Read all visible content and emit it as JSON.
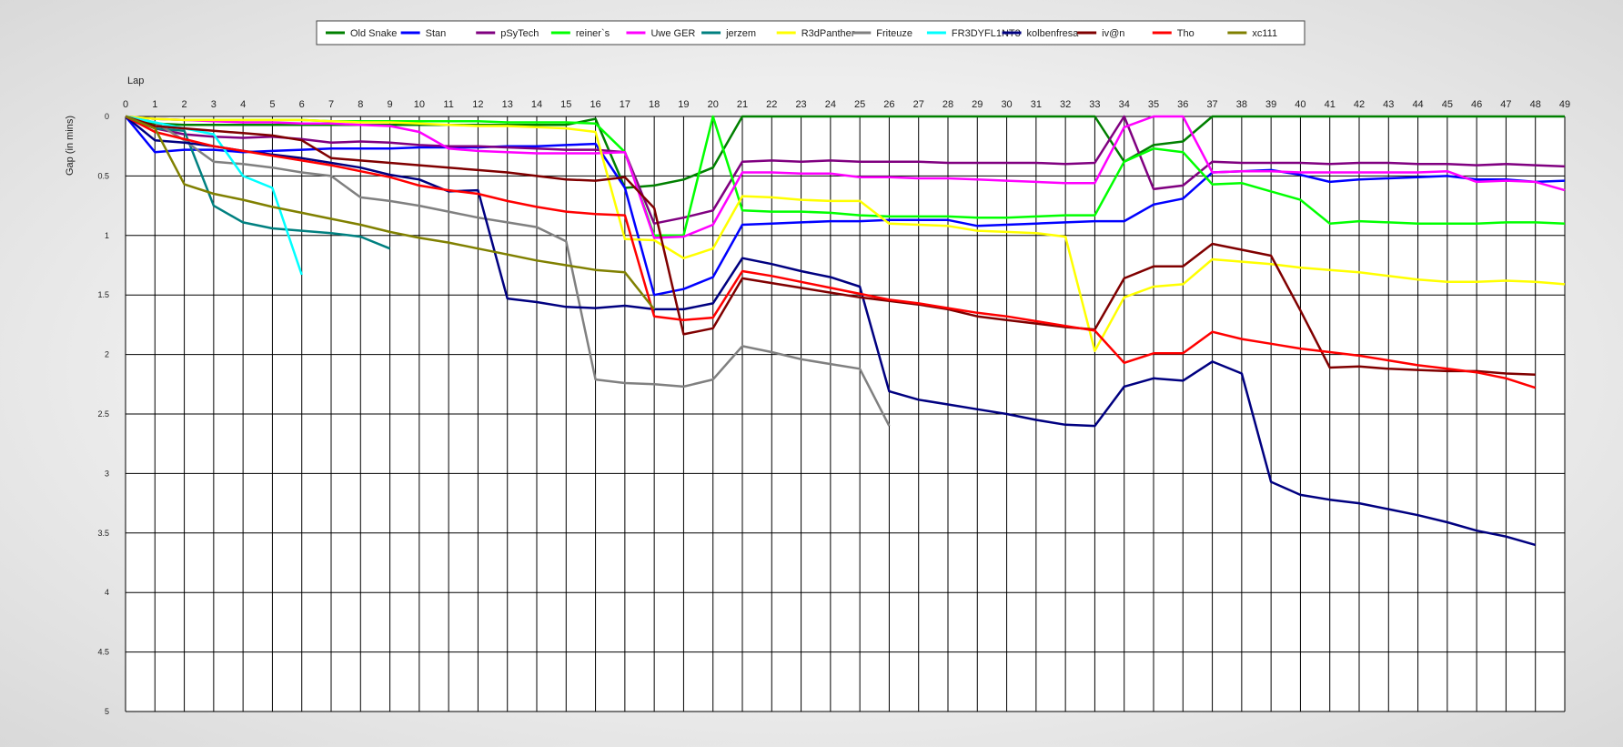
{
  "chart_data": {
    "type": "line",
    "title": "",
    "xlabel": "Lap",
    "ylabel": "Gap (in mins)",
    "xlim": [
      0,
      49
    ],
    "ylim": [
      0,
      5
    ],
    "y_inverted": true,
    "grid": true,
    "legend_position": "top",
    "x_ticks": [
      0,
      1,
      2,
      3,
      4,
      5,
      6,
      7,
      8,
      9,
      10,
      11,
      12,
      13,
      14,
      15,
      16,
      17,
      18,
      19,
      20,
      21,
      22,
      23,
      24,
      25,
      26,
      27,
      28,
      29,
      30,
      31,
      32,
      33,
      34,
      35,
      36,
      37,
      38,
      39,
      40,
      41,
      42,
      43,
      44,
      45,
      46,
      47,
      48,
      49
    ],
    "y_ticks": [
      "0",
      "0.5",
      "1",
      "1.5",
      "2",
      "2.5",
      "3",
      "3.5",
      "4",
      "4.5",
      "5"
    ],
    "series": [
      {
        "name": "Old Snake",
        "color": "#008000",
        "values": [
          0,
          0.06,
          0.07,
          0.07,
          0.07,
          0.07,
          0.07,
          0.07,
          0.07,
          0.07,
          0.07,
          0.07,
          0.07,
          0.07,
          0.07,
          0.07,
          0.02,
          0.6,
          0.58,
          0.53,
          0.43,
          0.0,
          0.0,
          0.0,
          0.0,
          0.0,
          0.0,
          0.0,
          0.0,
          0.0,
          0.0,
          0.0,
          0.0,
          0.0,
          0.38,
          0.24,
          0.21,
          0.0,
          0.0,
          0.0,
          0.0,
          0.0,
          0.0,
          0.0,
          0.0,
          0.0,
          0.0,
          0.0,
          0.0,
          0.0
        ]
      },
      {
        "name": "Stan",
        "color": "#0000ff",
        "values": [
          0,
          0.3,
          0.28,
          0.28,
          0.3,
          0.29,
          0.28,
          0.27,
          0.27,
          0.27,
          0.26,
          0.26,
          0.26,
          0.25,
          0.25,
          0.24,
          0.23,
          0.6,
          1.5,
          1.45,
          1.35,
          0.91,
          0.9,
          0.89,
          0.88,
          0.88,
          0.87,
          0.87,
          0.87,
          0.92,
          0.91,
          0.9,
          0.89,
          0.88,
          0.88,
          0.74,
          0.69,
          0.47,
          0.46,
          0.45,
          0.49,
          0.55,
          0.53,
          0.52,
          0.51,
          0.5,
          0.53,
          0.53,
          0.55,
          0.54
        ]
      },
      {
        "name": "pSyTech",
        "color": "#800080",
        "values": [
          0,
          0.1,
          0.15,
          0.17,
          0.18,
          0.17,
          0.19,
          0.22,
          0.21,
          0.22,
          0.24,
          0.25,
          0.25,
          0.26,
          0.27,
          0.28,
          0.28,
          0.3,
          0.9,
          0.85,
          0.79,
          0.38,
          0.37,
          0.38,
          0.37,
          0.38,
          0.38,
          0.38,
          0.39,
          0.39,
          0.39,
          0.39,
          0.4,
          0.39,
          0.0,
          0.61,
          0.58,
          0.38,
          0.39,
          0.39,
          0.39,
          0.4,
          0.39,
          0.39,
          0.4,
          0.4,
          0.41,
          0.4,
          0.41,
          0.42
        ]
      },
      {
        "name": "reiner`s",
        "color": "#00ff00",
        "values": [
          0,
          0.02,
          0.03,
          0.03,
          0.03,
          0.03,
          0.03,
          0.04,
          0.04,
          0.04,
          0.04,
          0.04,
          0.04,
          0.05,
          0.05,
          0.05,
          0.06,
          0.3,
          1.0,
          1.0,
          0.0,
          0.79,
          0.8,
          0.8,
          0.81,
          0.83,
          0.84,
          0.84,
          0.84,
          0.85,
          0.85,
          0.84,
          0.83,
          0.83,
          0.38,
          0.27,
          0.3,
          0.57,
          0.56,
          0.63,
          0.7,
          0.9,
          0.88,
          0.89,
          0.9,
          0.9,
          0.9,
          0.89,
          0.89,
          0.9
        ]
      },
      {
        "name": "Uwe GER",
        "color": "#ff00ff",
        "values": [
          0,
          0.02,
          0.03,
          0.04,
          0.05,
          0.05,
          0.06,
          0.06,
          0.07,
          0.08,
          0.13,
          0.27,
          0.29,
          0.3,
          0.31,
          0.31,
          0.31,
          0.3,
          1.02,
          1.01,
          0.91,
          0.47,
          0.47,
          0.48,
          0.48,
          0.51,
          0.51,
          0.52,
          0.52,
          0.53,
          0.54,
          0.55,
          0.56,
          0.56,
          0.09,
          0.0,
          0.0,
          0.47,
          0.46,
          0.46,
          0.47,
          0.47,
          0.47,
          0.47,
          0.47,
          0.46,
          0.55,
          0.54,
          0.55,
          0.62
        ]
      },
      {
        "name": "jerzem",
        "color": "#008080",
        "values": [
          0,
          0.1,
          0.12,
          0.75,
          0.89,
          0.94,
          0.96,
          0.98,
          1.01,
          1.11
        ]
      },
      {
        "name": "R3dPanther",
        "color": "#ffff00",
        "values": [
          0,
          0.02,
          0.03,
          0.03,
          0.03,
          0.03,
          0.03,
          0.04,
          0.05,
          0.05,
          0.06,
          0.07,
          0.08,
          0.08,
          0.09,
          0.1,
          0.13,
          1.03,
          1.04,
          1.19,
          1.11,
          0.67,
          0.68,
          0.7,
          0.71,
          0.71,
          0.9,
          0.91,
          0.92,
          0.96,
          0.97,
          0.98,
          1.01,
          1.97,
          1.52,
          1.43,
          1.41,
          1.2,
          1.22,
          1.24,
          1.27,
          1.29,
          1.31,
          1.34,
          1.37,
          1.39,
          1.39,
          1.38,
          1.39,
          1.41
        ]
      },
      {
        "name": "Friteuze",
        "color": "#808080",
        "values": [
          0,
          0.05,
          0.2,
          0.38,
          0.4,
          0.43,
          0.47,
          0.5,
          0.68,
          0.71,
          0.75,
          0.8,
          0.85,
          0.89,
          0.93,
          1.05,
          2.21,
          2.24,
          2.25,
          2.27,
          2.21,
          1.93,
          1.98,
          2.04,
          2.08,
          2.12,
          2.6
        ]
      },
      {
        "name": "FR3DYFL1NT3",
        "color": "#00ffff",
        "values": [
          0,
          0.05,
          0.1,
          0.15,
          0.5,
          0.6,
          1.33
        ]
      },
      {
        "name": "kolbenfresa",
        "color": "#000080",
        "values": [
          0,
          0.2,
          0.22,
          0.25,
          0.29,
          0.32,
          0.35,
          0.39,
          0.43,
          0.49,
          0.53,
          0.63,
          0.62,
          1.53,
          1.56,
          1.6,
          1.61,
          1.59,
          1.62,
          1.62,
          1.57,
          1.19,
          1.24,
          1.3,
          1.35,
          1.43,
          2.31,
          2.38,
          2.42,
          2.46,
          2.5,
          2.55,
          2.59,
          2.6,
          2.27,
          2.2,
          2.22,
          2.06,
          2.16,
          3.07,
          3.18,
          3.22,
          3.25,
          3.3,
          3.35,
          3.41,
          3.48,
          3.53,
          3.6
        ]
      },
      {
        "name": "iv@n",
        "color": "#800000",
        "values": [
          0,
          0.08,
          0.1,
          0.12,
          0.14,
          0.16,
          0.2,
          0.35,
          0.37,
          0.39,
          0.41,
          0.43,
          0.45,
          0.47,
          0.5,
          0.53,
          0.54,
          0.51,
          0.77,
          1.83,
          1.78,
          1.36,
          1.4,
          1.44,
          1.48,
          1.52,
          1.55,
          1.58,
          1.62,
          1.68,
          1.71,
          1.74,
          1.77,
          1.79,
          1.36,
          1.26,
          1.26,
          1.07,
          1.12,
          1.17,
          1.63,
          2.11,
          2.1,
          2.12,
          2.13,
          2.14,
          2.14,
          2.16,
          2.17
        ]
      },
      {
        "name": "Tho",
        "color": "#ff0000",
        "values": [
          0,
          0.13,
          0.19,
          0.25,
          0.29,
          0.33,
          0.37,
          0.41,
          0.46,
          0.51,
          0.58,
          0.62,
          0.65,
          0.71,
          0.76,
          0.8,
          0.82,
          0.83,
          1.68,
          1.71,
          1.69,
          1.3,
          1.34,
          1.39,
          1.44,
          1.49,
          1.54,
          1.57,
          1.61,
          1.65,
          1.68,
          1.72,
          1.76,
          1.8,
          2.07,
          1.99,
          1.99,
          1.81,
          1.87,
          1.91,
          1.95,
          1.98,
          2.01,
          2.05,
          2.09,
          2.12,
          2.15,
          2.2,
          2.28
        ]
      },
      {
        "name": "xc111",
        "color": "#808000",
        "values": [
          0,
          0.1,
          0.57,
          0.65,
          0.7,
          0.76,
          0.81,
          0.86,
          0.91,
          0.97,
          1.02,
          1.06,
          1.11,
          1.16,
          1.21,
          1.25,
          1.29,
          1.31,
          1.62
        ]
      }
    ]
  }
}
